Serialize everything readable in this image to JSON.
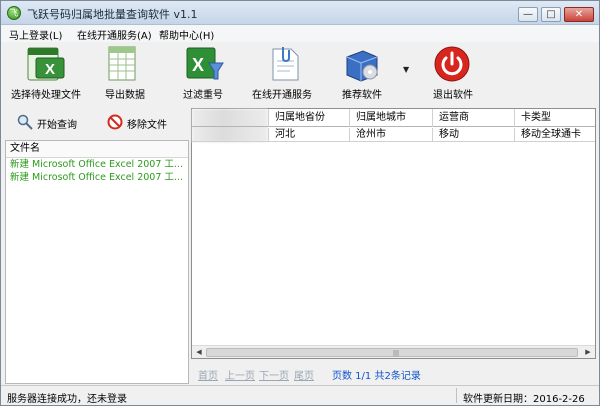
{
  "window": {
    "title": "飞跃号码归属地批量查询软件 v1.1",
    "min_glyph": "—",
    "max_glyph": "□",
    "close_glyph": "✕"
  },
  "menu": [
    "马上登录(L)",
    "在线开通服务(A)",
    "帮助中心(H)"
  ],
  "toolbar": {
    "select_file": "选择待处理文件",
    "export": "导出数据",
    "filter_dup": "过滤重号",
    "open_service": "在线开通服务",
    "recommend": "推荐软件",
    "dropdown_glyph": "▼",
    "exit": "退出软件"
  },
  "actions": {
    "start_query": "开始查询",
    "remove_file": "移除文件"
  },
  "file_list": {
    "header": "文件名",
    "items": [
      "新建 Microsoft Office Excel 2007 工...",
      "新建 Microsoft Office Excel 2007 工..."
    ]
  },
  "grid": {
    "columns": [
      "归属地省份",
      "归属地城市",
      "运营商",
      "卡类型"
    ],
    "rows": [
      [
        "河北",
        "沧州市",
        "移动",
        "移动全球通卡"
      ]
    ],
    "scroll_glyphs": {
      "left": "◀",
      "right": "▶",
      "grip": "|||"
    }
  },
  "pager": {
    "first": "首页",
    "prev": "上一页",
    "next": "下一页",
    "last": "尾页",
    "info": "页数 1/1 共2条记录"
  },
  "status": {
    "left": "服务器连接成功，还未登录",
    "right": "软件更新日期：2016-2-26"
  }
}
